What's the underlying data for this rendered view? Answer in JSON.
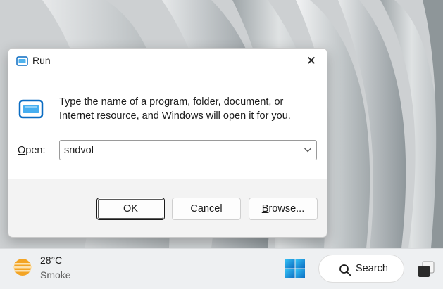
{
  "dialog": {
    "title": "Run",
    "close_symbol": "✕",
    "icon": "run-icon",
    "description": "Type the name of a program, folder, document, or Internet resource, and Windows will open it for you.",
    "open_label_prefix": "",
    "open_label_underlined": "O",
    "open_label_rest": "pen:",
    "open_value": "sndvol",
    "buttons": {
      "ok": "OK",
      "cancel": "Cancel",
      "browse_underlined": "B",
      "browse_rest": "rowse..."
    }
  },
  "taskbar": {
    "weather": {
      "temperature": "28°C",
      "condition": "Smoke",
      "icon": "smoke-weather-icon"
    },
    "start_icon": "windows-logo-icon",
    "search_label": "Search",
    "search_icon": "search-icon",
    "task_view_icon": "task-view-icon"
  },
  "colors": {
    "accent": "#0a6cc2",
    "dialog_bg": "#ffffff",
    "dialog_footer": "#f3f3f3",
    "taskbar_bg": "#eef0f2"
  }
}
